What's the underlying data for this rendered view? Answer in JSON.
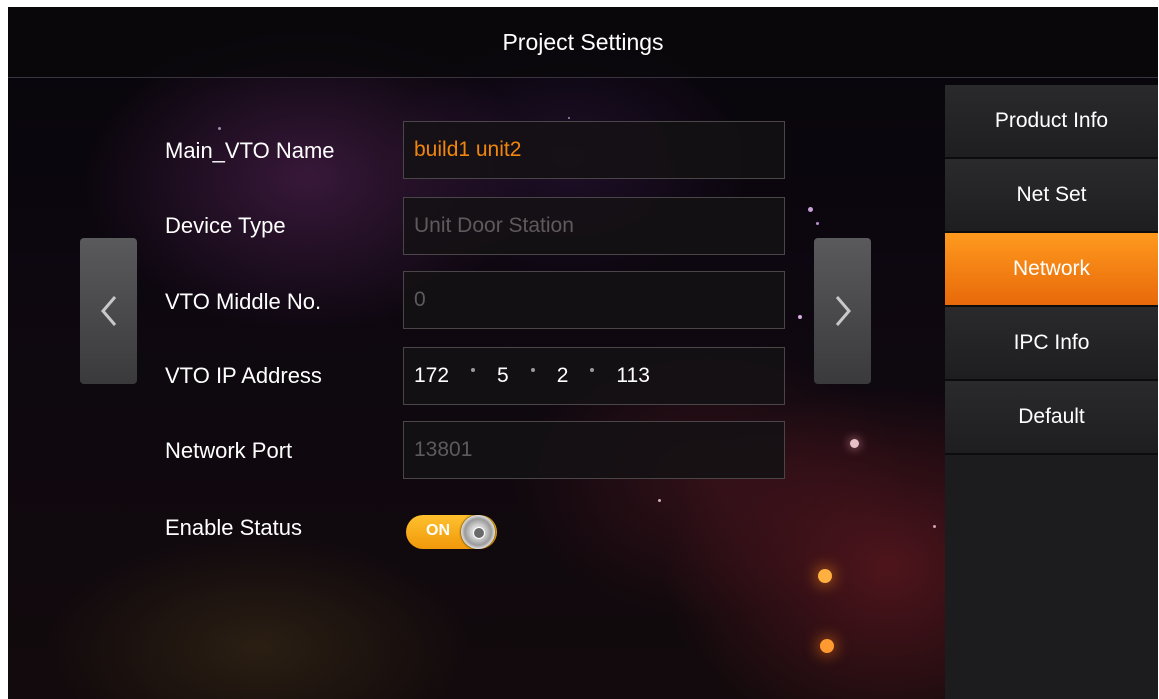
{
  "header": {
    "title": "Project Settings"
  },
  "sidebar": {
    "items": [
      {
        "label": "Product Info"
      },
      {
        "label": "Net Set"
      },
      {
        "label": "Network"
      },
      {
        "label": "IPC Info"
      },
      {
        "label": "Default"
      }
    ],
    "active_index": 2
  },
  "form": {
    "main_vto_name": {
      "label": "Main_VTO Name",
      "value": "build1 unit2"
    },
    "device_type": {
      "label": "Device Type",
      "value": "Unit Door Station"
    },
    "vto_middle_no": {
      "label": "VTO Middle No.",
      "value": "0"
    },
    "vto_ip_address": {
      "label": "VTO IP Address",
      "octets": [
        "172",
        "5",
        "2",
        "113"
      ]
    },
    "network_port": {
      "label": "Network Port",
      "value": "13801"
    },
    "enable_status": {
      "label": "Enable Status",
      "toggle_label": "ON",
      "state": "on"
    }
  },
  "nav": {
    "prev_icon": "chevron-left-icon",
    "next_icon": "chevron-right-icon"
  },
  "colors": {
    "accent": "#f08a12",
    "value_text": "#f0860e",
    "disabled_text": "#5e5a5c"
  }
}
